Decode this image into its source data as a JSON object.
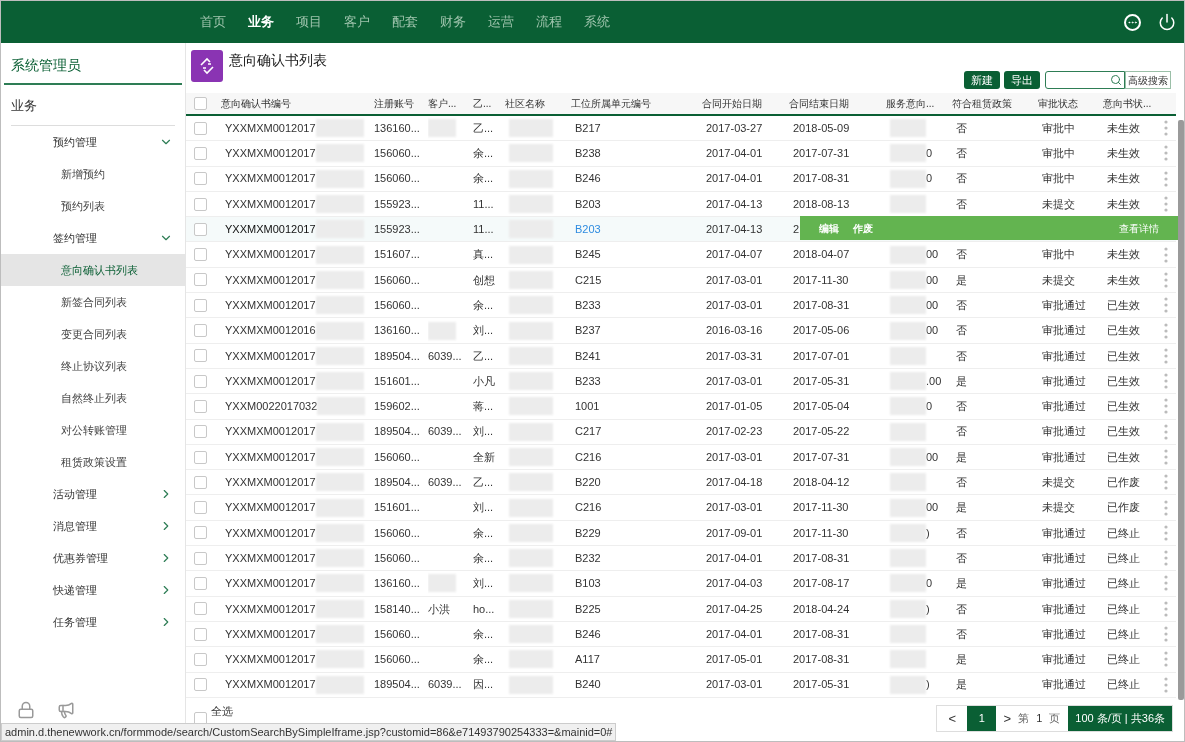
{
  "top_nav": [
    {
      "label": "首页",
      "selected": false
    },
    {
      "label": "业务",
      "selected": true
    },
    {
      "label": "项目",
      "selected": false
    },
    {
      "label": "客户",
      "selected": false
    },
    {
      "label": "配套",
      "selected": false
    },
    {
      "label": "财务",
      "selected": false
    },
    {
      "label": "运营",
      "selected": false
    },
    {
      "label": "流程",
      "selected": false
    },
    {
      "label": "系统",
      "selected": false
    }
  ],
  "sidebar": {
    "user": "系统管理员",
    "section": "业务",
    "items": [
      {
        "label": "预约管理",
        "expanded": true,
        "children": [
          {
            "label": "新增预约",
            "selected": false
          },
          {
            "label": "预约列表",
            "selected": false
          }
        ]
      },
      {
        "label": "签约管理",
        "expanded": true,
        "children": [
          {
            "label": "意向确认书列表",
            "selected": true
          },
          {
            "label": "新签合同列表",
            "selected": false
          },
          {
            "label": "变更合同列表",
            "selected": false
          },
          {
            "label": "终止协议列表",
            "selected": false
          },
          {
            "label": "自然终止列表",
            "selected": false
          },
          {
            "label": "对公转账管理",
            "selected": false
          },
          {
            "label": "租赁政策设置",
            "selected": false
          }
        ]
      },
      {
        "label": "活动管理",
        "expanded": false
      },
      {
        "label": "消息管理",
        "expanded": false
      },
      {
        "label": "优惠券管理",
        "expanded": false
      },
      {
        "label": "快递管理",
        "expanded": false
      },
      {
        "label": "任务管理",
        "expanded": false
      }
    ]
  },
  "page_title": "意向确认书列表",
  "toolbar": {
    "buttons": [
      "新建",
      "导出"
    ],
    "advanced_search": "高级搜索"
  },
  "table": {
    "header_checkbox": {
      "checked": false
    },
    "columns": [
      "意向确认书编号",
      "注册账号",
      "客户...",
      "乙...",
      "社区名称",
      "工位所属单元编号",
      "合同开始日期",
      "合同结束日期",
      "服务意向...",
      "符合租赁政策",
      "审批状态",
      "意向书状..."
    ],
    "rows": [
      {
        "checked": false,
        "hovered": false,
        "id": "YXXMXM0012017",
        "account": "136160...",
        "customer_hidden": true,
        "party": "乙...",
        "unit": "B217",
        "start": "2017-03-27",
        "end": "2018-05-09",
        "policy": "否",
        "approval": "审批中",
        "status": "未生效"
      },
      {
        "checked": false,
        "hovered": false,
        "id": "YXXMXM0012017",
        "account": "156060...",
        "customer_hidden": false,
        "party": "余...",
        "unit": "B238",
        "start": "2017-04-01",
        "end": "2017-07-31",
        "service": "0",
        "policy": "否",
        "approval": "审批中",
        "status": "未生效"
      },
      {
        "checked": false,
        "hovered": false,
        "id": "YXXMXM0012017",
        "account": "156060...",
        "customer_hidden": false,
        "party": "余...",
        "unit": "B246",
        "start": "2017-04-01",
        "end": "2017-08-31",
        "service": "0",
        "policy": "否",
        "approval": "审批中",
        "status": "未生效"
      },
      {
        "checked": false,
        "hovered": false,
        "id": "YXXMXM0012017",
        "account": "155923...",
        "customer_hidden": false,
        "party": "11...",
        "unit": "B203",
        "start": "2017-04-13",
        "end": "2018-08-13",
        "policy": "否",
        "approval": "未提交",
        "status": "未生效"
      },
      {
        "checked": false,
        "hovered": true,
        "id": "YXXMXM0012017",
        "account": "155923...",
        "customer_hidden": false,
        "party": "11...",
        "unit": "B203",
        "start": "2017-04-13",
        "end": "2",
        "actions": [
          {
            "label": "编辑"
          },
          {
            "label": "作废"
          },
          {
            "label": "查看详情"
          }
        ]
      },
      {
        "checked": false,
        "hovered": false,
        "id": "YXXMXM0012017",
        "account": "151607...",
        "customer_hidden": false,
        "party": "真...",
        "unit": "B245",
        "start": "2017-04-07",
        "end": "2018-04-07",
        "service": "00",
        "policy": "否",
        "approval": "审批中",
        "status": "未生效"
      },
      {
        "checked": false,
        "hovered": false,
        "id": "YXXMXM0012017",
        "account": "156060...",
        "customer_hidden": false,
        "party": "创想",
        "unit": "C215",
        "start": "2017-03-01",
        "end": "2017-11-30",
        "service": "00",
        "policy": "是",
        "approval": "未提交",
        "status": "未生效"
      },
      {
        "checked": false,
        "hovered": false,
        "id": "YXXMXM0012017",
        "account": "156060...",
        "customer_hidden": false,
        "party": "余...",
        "unit": "B233",
        "start": "2017-03-01",
        "end": "2017-08-31",
        "service": "00",
        "policy": "否",
        "approval": "审批通过",
        "status": "已生效"
      },
      {
        "checked": false,
        "hovered": false,
        "id": "YXXMXM0012016",
        "account": "136160...",
        "customer_hidden": true,
        "party": "刘...",
        "unit": "B237",
        "start": "2016-03-16",
        "end": "2017-05-06",
        "service": "00",
        "policy": "否",
        "approval": "审批通过",
        "status": "已生效"
      },
      {
        "checked": false,
        "hovered": false,
        "id": "YXXMXM0012017",
        "account": "189504...",
        "customer": "6039...",
        "customer_hidden": false,
        "party": "乙...",
        "unit": "B241",
        "start": "2017-03-31",
        "end": "2017-07-01",
        "policy": "否",
        "approval": "审批通过",
        "status": "已生效"
      },
      {
        "checked": false,
        "hovered": false,
        "id": "YXXMXM0012017",
        "account": "151601...",
        "customer_hidden": false,
        "party": "小凡",
        "unit": "B233",
        "start": "2017-03-01",
        "end": "2017-05-31",
        "service": ".00",
        "policy": "是",
        "approval": "审批通过",
        "status": "已生效"
      },
      {
        "checked": false,
        "hovered": false,
        "id": "YXXM0022017032",
        "account": "159602...",
        "customer_hidden": false,
        "party": "蒋...",
        "unit": "1001",
        "start": "2017-01-05",
        "end": "2017-05-04",
        "service": "0",
        "policy": "否",
        "approval": "审批通过",
        "status": "已生效"
      },
      {
        "checked": false,
        "hovered": false,
        "id": "YXXMXM0012017",
        "account": "189504...",
        "customer": "6039...",
        "customer_hidden": false,
        "party": "刘...",
        "unit": "C217",
        "start": "2017-02-23",
        "end": "2017-05-22",
        "policy": "否",
        "approval": "审批通过",
        "status": "已生效"
      },
      {
        "checked": false,
        "hovered": false,
        "id": "YXXMXM0012017",
        "account": "156060...",
        "customer_hidden": false,
        "party": "全新",
        "unit": "C216",
        "start": "2017-03-01",
        "end": "2017-07-31",
        "service": "00",
        "policy": "是",
        "approval": "审批通过",
        "status": "已生效"
      },
      {
        "checked": false,
        "hovered": false,
        "id": "YXXMXM0012017",
        "account": "189504...",
        "customer": "6039...",
        "customer_hidden": false,
        "party": "乙...",
        "unit": "B220",
        "start": "2017-04-18",
        "end": "2018-04-12",
        "policy": "否",
        "approval": "未提交",
        "status": "已作废"
      },
      {
        "checked": false,
        "hovered": false,
        "id": "YXXMXM0012017",
        "account": "151601...",
        "customer_hidden": false,
        "party": "刘...",
        "unit": "C216",
        "start": "2017-03-01",
        "end": "2017-11-30",
        "service": "00",
        "policy": "是",
        "approval": "未提交",
        "status": "已作废"
      },
      {
        "checked": false,
        "hovered": false,
        "id": "YXXMXM0012017",
        "account": "156060...",
        "customer_hidden": false,
        "party": "余...",
        "unit": "B229",
        "start": "2017-09-01",
        "end": "2017-11-30",
        "service": ")",
        "policy": "否",
        "approval": "审批通过",
        "status": "已终止"
      },
      {
        "checked": false,
        "hovered": false,
        "id": "YXXMXM0012017",
        "account": "156060...",
        "customer_hidden": false,
        "party": "余...",
        "unit": "B232",
        "start": "2017-04-01",
        "end": "2017-08-31",
        "policy": "否",
        "approval": "审批通过",
        "status": "已终止"
      },
      {
        "checked": false,
        "hovered": false,
        "id": "YXXMXM0012017",
        "account": "136160...",
        "customer_hidden": true,
        "party": "刘...",
        "unit": "B103",
        "start": "2017-04-03",
        "end": "2017-08-17",
        "service": "0",
        "policy": "是",
        "approval": "审批通过",
        "status": "已终止"
      },
      {
        "checked": false,
        "hovered": false,
        "id": "YXXMXM0012017",
        "account": "158140...",
        "customer": "小洪",
        "customer_hidden": false,
        "party": "ho...",
        "unit": "B225",
        "start": "2017-04-25",
        "end": "2018-04-24",
        "service": ")",
        "policy": "否",
        "approval": "审批通过",
        "status": "已终止"
      },
      {
        "checked": false,
        "hovered": false,
        "id": "YXXMXM0012017",
        "account": "156060...",
        "customer_hidden": false,
        "party": "余...",
        "unit": "B246",
        "start": "2017-04-01",
        "end": "2017-08-31",
        "policy": "否",
        "approval": "审批通过",
        "status": "已终止"
      },
      {
        "checked": false,
        "hovered": false,
        "id": "YXXMXM0012017",
        "account": "156060...",
        "customer_hidden": false,
        "party": "余...",
        "unit": "A117",
        "start": "2017-05-01",
        "end": "2017-08-31",
        "policy": "是",
        "approval": "审批通过",
        "status": "已终止"
      },
      {
        "checked": false,
        "hovered": false,
        "id": "YXXMXM0012017",
        "account": "189504...",
        "customer": "6039...",
        "customer_hidden": false,
        "party": "因...",
        "unit": "B240",
        "start": "2017-03-01",
        "end": "2017-05-31",
        "service": ")",
        "policy": "是",
        "approval": "审批通过",
        "status": "已终止"
      }
    ]
  },
  "footer": {
    "select_all": {
      "label": "全选",
      "checked": false
    },
    "pagination": {
      "prev": "<",
      "pages": [
        {
          "label": "1",
          "selected": true
        }
      ],
      "next": ">",
      "page_prefix": "第",
      "page_input": "1",
      "page_suffix": "页",
      "page_size": "100 条/页 | 共36条"
    }
  },
  "status_url": "admin.d.thenewwork.cn/formmode/search/CustomSearchBySimpleIframe.jsp?customid=86&e71493790254333=&mainid=0#"
}
